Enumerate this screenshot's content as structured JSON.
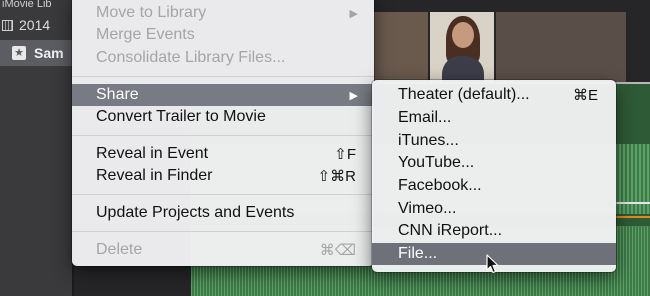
{
  "sidebar": {
    "header_label": "iMovie Lib",
    "year_label": "2014",
    "event_label": "Sam"
  },
  "main_menu": {
    "items": [
      {
        "label": "Move to Library",
        "shortcut": "",
        "disabled": true,
        "submenu": true
      },
      {
        "label": "Merge Events",
        "shortcut": "",
        "disabled": true
      },
      {
        "label": "Consolidate Library Files...",
        "shortcut": "",
        "disabled": true
      },
      {
        "label": "Share",
        "shortcut": "",
        "highlighted": true,
        "submenu": true
      },
      {
        "label": "Convert Trailer to Movie",
        "shortcut": ""
      },
      {
        "label": "Reveal in Event",
        "shortcut": "⇧F"
      },
      {
        "label": "Reveal in Finder",
        "shortcut": "⇧⌘R"
      },
      {
        "label": "Update Projects and Events",
        "shortcut": ""
      },
      {
        "label": "Delete",
        "shortcut": "⌘⌫",
        "disabled": true
      }
    ],
    "submenu_arrow": "▶"
  },
  "share_menu": {
    "items": [
      {
        "label": "Theater (default)...",
        "shortcut": "⌘E"
      },
      {
        "label": "Email..."
      },
      {
        "label": "iTunes..."
      },
      {
        "label": "YouTube..."
      },
      {
        "label": "Facebook..."
      },
      {
        "label": "Vimeo..."
      },
      {
        "label": "CNN iReport..."
      },
      {
        "label": "File...",
        "highlighted": true
      }
    ]
  },
  "colors": {
    "menu_bg": "#f1f1f3",
    "highlight": "#787a84",
    "disabled_text": "#a5a5a8",
    "event_selected": "#5b5d62",
    "audio_wave": "#3e7a48"
  },
  "icons": {
    "year": "calendar-icon",
    "event": "star-icon",
    "submenu": "chevron-right-icon",
    "pointer": "mouse-pointer-icon"
  }
}
